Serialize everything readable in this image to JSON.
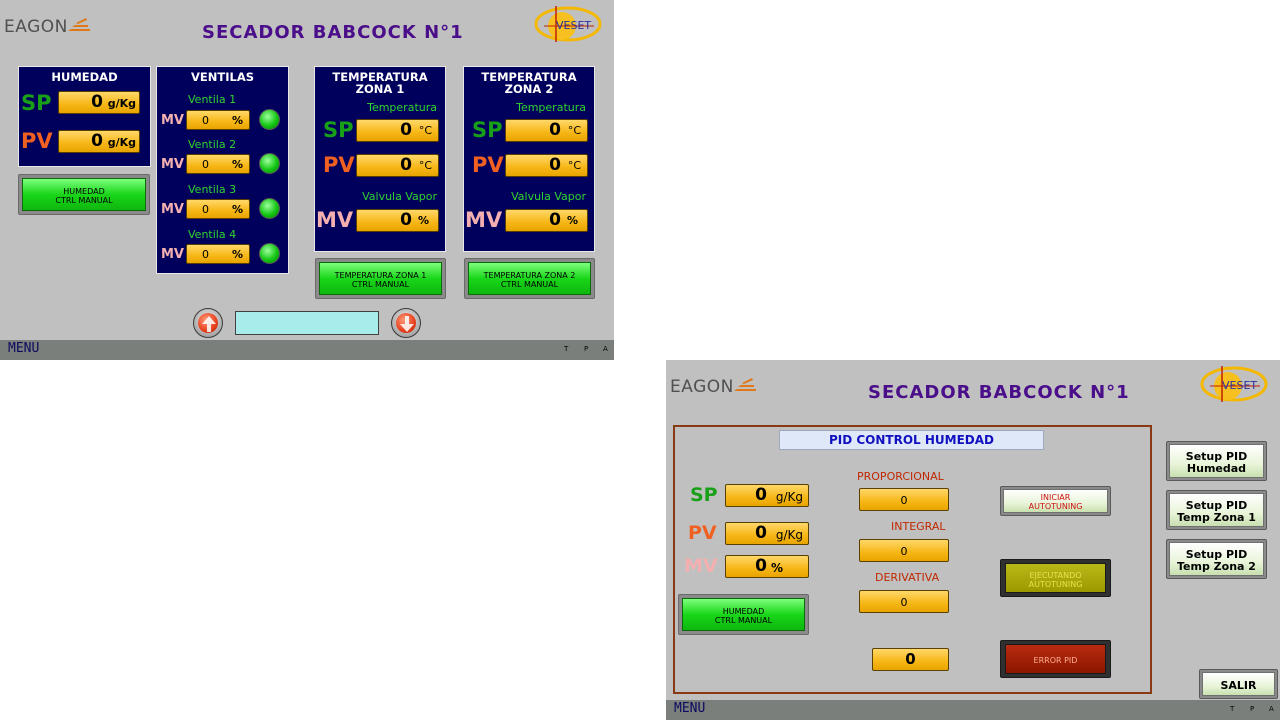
{
  "screen1": {
    "logo": "EAGON",
    "title": "SECADOR BABCOCK N°1",
    "veset_logo": "VESET",
    "humedad": {
      "title": "HUMEDAD",
      "sp_label": "SP",
      "sp_value": "0",
      "sp_unit": "g/Kg",
      "pv_label": "PV",
      "pv_value": "0",
      "pv_unit": "g/Kg",
      "button_line1": "HUMEDAD",
      "button_line2": "CTRL MANUAL"
    },
    "ventilas": {
      "title": "VENTILAS",
      "mv_label": "MV",
      "items": [
        {
          "label": "Ventila 1",
          "value": "0",
          "unit": "%"
        },
        {
          "label": "Ventila 2",
          "value": "0",
          "unit": "%"
        },
        {
          "label": "Ventila 3",
          "value": "0",
          "unit": "%"
        },
        {
          "label": "Ventila 4",
          "value": "0",
          "unit": "%"
        }
      ]
    },
    "zona1": {
      "title_line1": "TEMPERATURA",
      "title_line2": "ZONA 1",
      "temp_label": "Temperatura",
      "sp_label": "SP",
      "sp_value": "0",
      "sp_unit": "°C",
      "pv_label": "PV",
      "pv_value": "0",
      "pv_unit": "°C",
      "valve_label": "Valvula Vapor",
      "mv_label": "MV",
      "mv_value": "0",
      "mv_unit": "%",
      "button_line1": "TEMPERATURA ZONA 1",
      "button_line2": "CTRL MANUAL"
    },
    "zona2": {
      "title_line1": "TEMPERATURA",
      "title_line2": "ZONA 2",
      "temp_label": "Temperatura",
      "sp_label": "SP",
      "sp_value": "0",
      "sp_unit": "°C",
      "pv_label": "PV",
      "pv_value": "0",
      "pv_unit": "°C",
      "valve_label": "Valvula Vapor",
      "mv_label": "MV",
      "mv_value": "0",
      "mv_unit": "%",
      "button_line1": "TEMPERATURA ZONA 2",
      "button_line2": "CTRL MANUAL"
    },
    "footer": {
      "menu": "MENU",
      "t": "T",
      "p": "P",
      "a": "A"
    },
    "icons": {
      "up": "arrow-up-icon",
      "down": "arrow-down-icon"
    }
  },
  "screen2": {
    "logo": "EAGON",
    "title": "SECADOR BABCOCK N°1",
    "veset_logo": "VESET",
    "pid_title": "PID CONTROL HUMEDAD",
    "sp_label": "SP",
    "sp_value": "0",
    "sp_unit": "g/Kg",
    "pv_label": "PV",
    "pv_value": "0",
    "pv_unit": "g/Kg",
    "mv_label": "MV",
    "mv_value": "0",
    "mv_unit": "%",
    "proporcional_label": "PROPORCIONAL",
    "proporcional_value": "0",
    "integral_label": "INTEGRAL",
    "integral_value": "0",
    "derivativa_label": "DERIVATIVA",
    "derivativa_value": "0",
    "bottom_value": "0",
    "manual_button_line1": "HUMEDAD",
    "manual_button_line2": "CTRL MANUAL",
    "iniciar_line1": "INICIAR",
    "iniciar_line2": "AUTOTUNING",
    "ejecutando_line1": "EJECUTANDO",
    "ejecutando_line2": "AUTOTUNING",
    "error_label": "ERROR PID",
    "setup_humedad_line1": "Setup PID",
    "setup_humedad_line2": "Humedad",
    "setup_zona1_line1": "Setup PID",
    "setup_zona1_line2": "Temp Zona 1",
    "setup_zona2_line1": "Setup PID",
    "setup_zona2_line2": "Temp Zona 2",
    "salir": "SALIR",
    "footer": {
      "menu": "MENU",
      "t": "T",
      "p": "P",
      "a": "A"
    }
  },
  "colors": {
    "background": "#c0c0c0",
    "panel_navy": "#00005c",
    "field_yellow": "#f6b615",
    "title_purple": "#4a0e8a",
    "sp_green": "#18a018",
    "pv_orange": "#f06020",
    "mv_pink": "#f4b0b0",
    "led_green": "#13c613",
    "error_red": "#a01a00",
    "ejecutando_olive": "#a8a800"
  }
}
